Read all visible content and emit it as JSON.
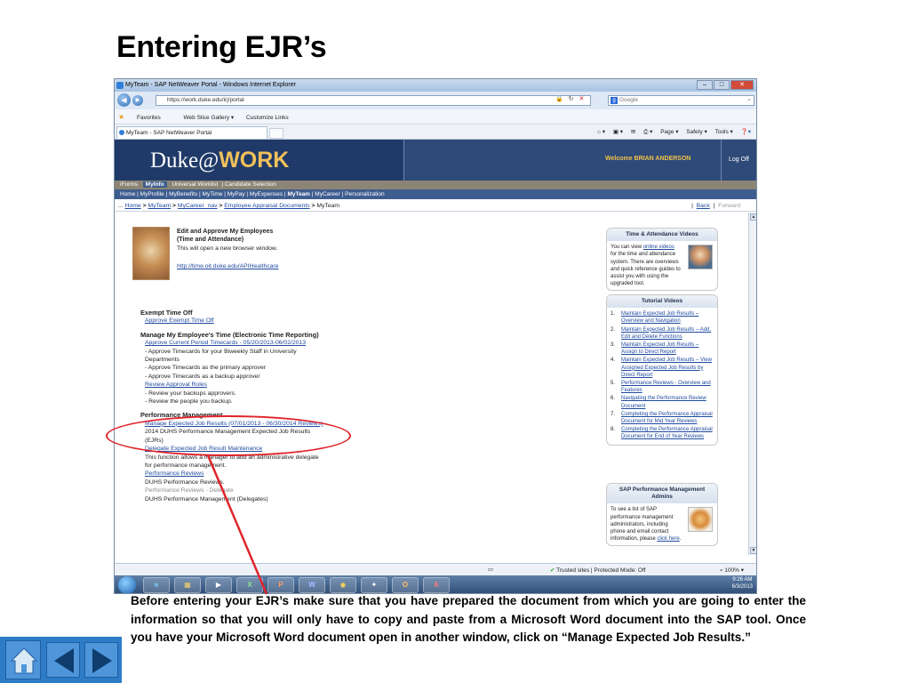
{
  "slide": {
    "title": "Entering EJR’s",
    "caption": " Before entering your EJR’s make sure that you have prepared the document from which you are going to enter the information so that you will only have to copy and paste from a Microsoft Word document into the SAP tool.   Once you have your Microsoft Word document open in another window, click on “Manage Expected Job Results.”"
  },
  "browser": {
    "window_title": "MyTeam - SAP NetWeaver Portal - Windows Internet Explorer",
    "address": "https://work.duke.edu/irj/portal",
    "search_placeholder": "Google",
    "favorites_label": "Favorites",
    "web_slice_label": "Web Slice Gallery ▾",
    "customize_links_label": "Customize Links",
    "tab_title": "MyTeam - SAP NetWeaver Portal",
    "cmd_page": "Page ▾",
    "cmd_safety": "Safety ▾",
    "cmd_tools": "Tools ▾",
    "status_zone": "Trusted sites | Protected Mode: Off",
    "status_zoom": "100%"
  },
  "portal": {
    "logo_duke": "Duke",
    "logo_at": "@",
    "logo_work": "WORK",
    "welcome": "Welcome BRIAN ANDERSON",
    "logoff": "Log Off",
    "top_tabs": [
      "iForms",
      "MyInfo",
      "Universal Worklist",
      "Candidate Selection"
    ],
    "sub_nav": [
      "Home",
      "MyProfile",
      "MyBenefits",
      "MyTime",
      "MyPay",
      "MyExpenses",
      "MyTeam",
      "MyCareer",
      "Personalization"
    ],
    "breadcrumb": {
      "prefix": "...",
      "items": [
        "Home",
        "MyTeam",
        "MyCareer_nav",
        "Employee Appraisal Documents"
      ],
      "current": "MyTeam",
      "back": "Back",
      "forward": "Forward"
    }
  },
  "content": {
    "edit_approve": {
      "title_line1": "Edit and Approve My Employees",
      "title_line2": "(Time and Attendance)",
      "note": "This will open a new browser window.",
      "link": "http://time.oit.duke.edu/APIHealthcare"
    },
    "exempt": {
      "heading": "Exempt Time Off",
      "link": "Approve Exempt Time Off"
    },
    "manage_time": {
      "heading": "Manage My Employee's Time (Electronic Time Reporting)",
      "link1": "Approve Current Period Timecards - 05/20/2013-06/02/2013",
      "desc1": "- Approve Timecards for your Biweekly Staff in University",
      "desc2": "Departments",
      "desc3": "- Approve Timecards as the primary approver",
      "desc4": "- Approve Timecards as a backup approver",
      "link2": "Review Approval Roles",
      "desc5": "- Review your backups approvers.",
      "desc6": "- Review the people you backup."
    },
    "performance": {
      "heading": "Performance Management",
      "link1": "Manage Expected Job Results (07/01/2013 - 06/30/2014 Reviews)",
      "desc1": "2014 DUHS Performance Management Expected Job Results",
      "desc2": "(EJRs)",
      "link2": "Delegate Expected Job Result Maintenance",
      "desc3": "This function allows a manager to add an administrative delegate",
      "desc4": "for performance management.",
      "link3": "Performance Reviews",
      "desc5": "DUHS Performance Reviews.",
      "link4": "Performance Reviews - Delegate",
      "desc6": "DUHS Performance Management (Delegates)"
    },
    "time_videos": {
      "header": "Time & Attendance Videos",
      "t1": "You can view",
      "link": "online videos",
      "t2": "for the time and attendance system. There are overviews and quick reference guides to assist you with using the upgraded tool."
    },
    "tutorials": {
      "header": "Tutorial Videos",
      "items": [
        "Maintain Expected Job Results – Overview and Navigation",
        "Maintain Expected Job Results – Add, Edit and Delete Functions",
        "Maintain Expected Job Results – Assign to Direct Report",
        "Maintain Expected Job Results – View Assigned Expected Job Results by Direct Report",
        "Performance Reviews - Overview and Features",
        "Navigating the Performance Review Document",
        "Completing the Performance Appraisal Document for Mid Year Reviews",
        "Completing the Performance Appraisal Document for End of Year Reviews"
      ]
    },
    "admins": {
      "header": "SAP Performance Management Admins",
      "text": "To see a list of SAP performance management administrators, including phone and email contact information, please",
      "link": "click here"
    }
  },
  "taskbar": {
    "time": "9:26 AM",
    "date": "6/3/2013"
  },
  "colors": {
    "annotation_red": "#e0242b",
    "portal_blue": "#1f3a68",
    "link_blue": "#1f4aa0",
    "nav_blue": "#2e7bc6"
  }
}
